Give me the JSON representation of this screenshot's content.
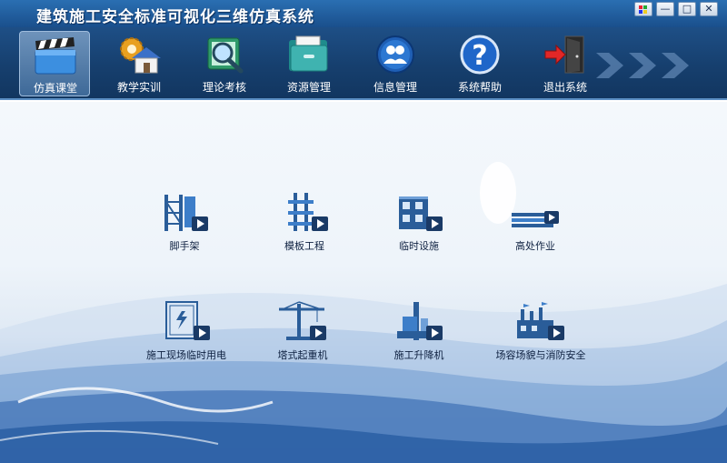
{
  "app": {
    "title": "建筑施工安全标准可视化三维仿真系统"
  },
  "window_controls": {
    "min": "—",
    "max": "□",
    "close": "✕"
  },
  "toolbar": {
    "items": [
      {
        "label": "仿真课堂",
        "icon": "clapperboard-icon",
        "active": true
      },
      {
        "label": "教学实训",
        "icon": "house-gear-icon"
      },
      {
        "label": "理论考核",
        "icon": "magnifier-book-icon"
      },
      {
        "label": "资源管理",
        "icon": "folder-icon"
      },
      {
        "label": "信息管理",
        "icon": "users-icon"
      },
      {
        "label": "系统帮助",
        "icon": "help-icon"
      },
      {
        "label": "退出系统",
        "icon": "exit-door-icon"
      }
    ]
  },
  "modules": [
    {
      "label": "脚手架",
      "icon": "scaffold-icon"
    },
    {
      "label": "模板工程",
      "icon": "formwork-icon"
    },
    {
      "label": "临时设施",
      "icon": "temporary-building-icon"
    },
    {
      "label": "高处作业",
      "icon": "high-work-icon"
    },
    {
      "label": "施工现场临时用电",
      "icon": "electric-box-icon"
    },
    {
      "label": "塔式起重机",
      "icon": "tower-crane-icon"
    },
    {
      "label": "施工升降机",
      "icon": "construction-hoist-icon"
    },
    {
      "label": "场容场貌与消防安全",
      "icon": "factory-fire-icon"
    }
  ],
  "colors": {
    "accent": "#1a4f8c",
    "toolbar": "#163f6e",
    "label": "#0e2040"
  }
}
